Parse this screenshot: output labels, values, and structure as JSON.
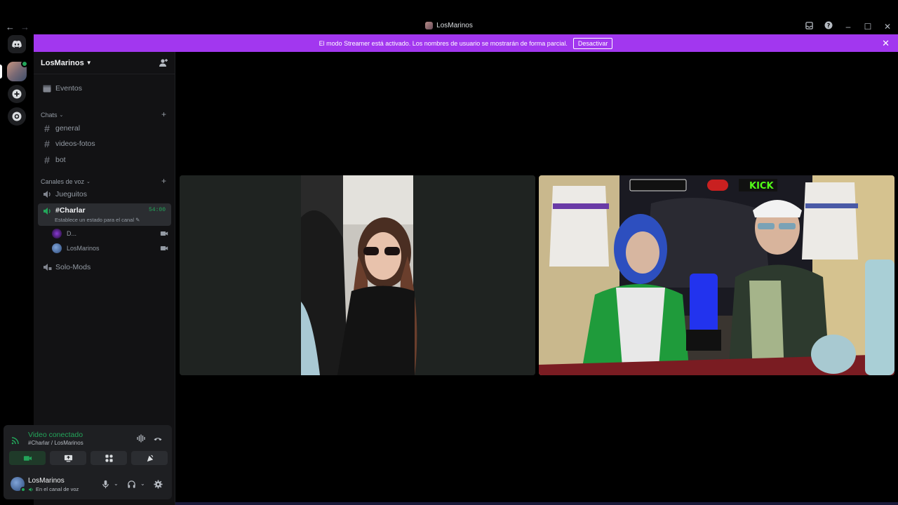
{
  "window": {
    "title": "LosMarinos"
  },
  "banner": {
    "message": "El modo Streamer está activado. Los nombres de usuario se mostrarán de forma parcial.",
    "button": "Desactivar"
  },
  "guild": {
    "name": "LosMarinos"
  },
  "sidebar": {
    "events": "Eventos",
    "chats_category": "Chats",
    "text_channels": [
      "general",
      "videos-fotos",
      "bot"
    ],
    "voice_category": "Canales de voz",
    "voice_channels": {
      "juegos": "Jueguitos",
      "active": "#Charlar",
      "active_timer": "54:00",
      "active_status": "Establece un estado para el canal",
      "members": [
        "D...",
        "LosMarinos"
      ],
      "mods": "Solo-Mods"
    }
  },
  "voice_panel": {
    "title": "Video conectado",
    "subtitle": "#Charlar / LosMarinos"
  },
  "user_panel": {
    "name": "LosMarinos",
    "status": "En el canal de voz"
  },
  "colors": {
    "accent": "#a237ef",
    "green": "#23a55a"
  }
}
